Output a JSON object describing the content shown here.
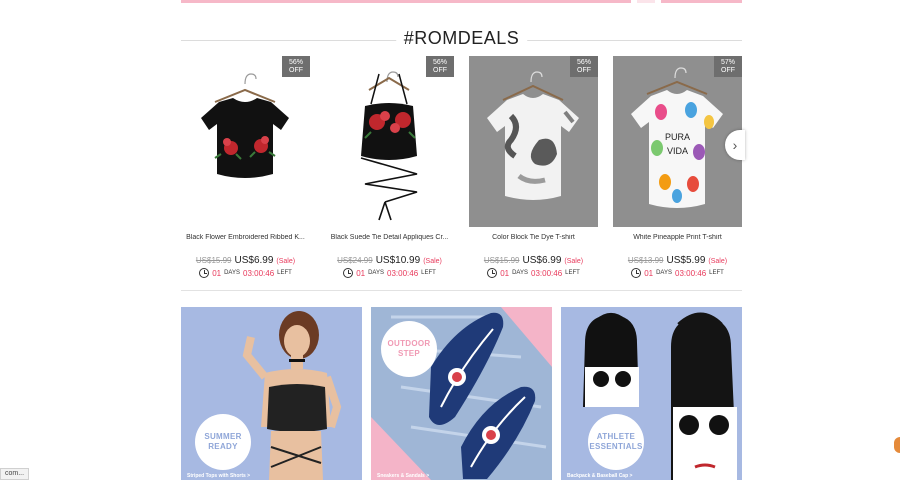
{
  "section": {
    "title": "#ROMDEALS"
  },
  "products": [
    {
      "name": "Black Flower Embroidered Ribbed K...",
      "discount": "56%",
      "off": "OFF",
      "old_price": "US$15.99",
      "price": "US$6.99",
      "sale": "(Sale)",
      "days": "01",
      "days_label": "DAYS",
      "time": "03:00:46",
      "left_label": "LEFT",
      "icon": "black-crop-top-image"
    },
    {
      "name": "Black Suede Tie Detail Appliques Cr...",
      "discount": "56%",
      "off": "OFF",
      "old_price": "US$24.99",
      "price": "US$10.99",
      "sale": "(Sale)",
      "days": "01",
      "days_label": "DAYS",
      "time": "03:00:46",
      "left_label": "LEFT",
      "icon": "halter-top-image"
    },
    {
      "name": "Color Block Tie Dye T-shirt",
      "discount": "56%",
      "off": "OFF",
      "old_price": "US$15.99",
      "price": "US$6.99",
      "sale": "(Sale)",
      "days": "01",
      "days_label": "DAYS",
      "time": "03:00:46",
      "left_label": "LEFT",
      "icon": "tie-dye-tshirt-image"
    },
    {
      "name": "White Pineapple Print T-shirt",
      "discount": "57%",
      "off": "OFF",
      "old_price": "US$13.99",
      "price": "US$5.99",
      "sale": "(Sale)",
      "days": "01",
      "days_label": "DAYS",
      "time": "03:00:46",
      "left_label": "LEFT",
      "icon": "pineapple-tshirt-image"
    }
  ],
  "carousel": {
    "next_symbol": "›"
  },
  "banners": [
    {
      "tag_line1": "SUMMER",
      "tag_line2": "READY",
      "caption": "Striped Tops with Shorts >",
      "color": "#a7b9e2"
    },
    {
      "tag_line1": "OUTDOOR",
      "tag_line2": "STEP",
      "caption": "Sneakers & Sandals >",
      "color": "#f4b4c8"
    },
    {
      "tag_line1": "ATHLETE",
      "tag_line2": "ESSENTIALS",
      "caption": "Backpack & Baseball Cap >",
      "color": "#a7b9e2"
    }
  ],
  "status_bar": {
    "url": "com..."
  },
  "colors": {
    "sale_red": "#e8395b",
    "badge_gray": "#6e6e6e",
    "pink": "#f4b4c8",
    "blue": "#a7b9e2"
  }
}
